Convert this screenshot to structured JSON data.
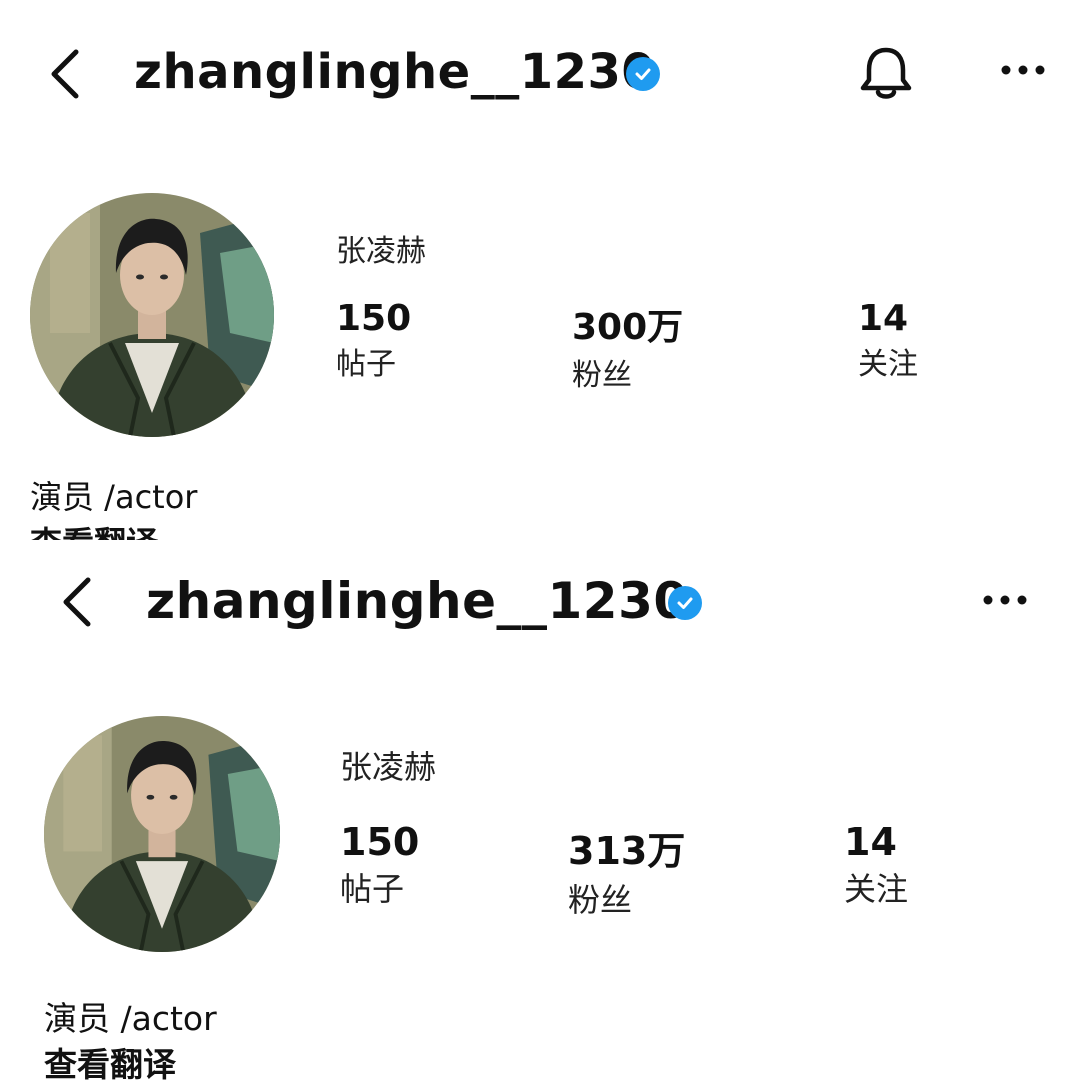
{
  "screenshots": [
    {
      "header": {
        "username": "zhanglinghe__1230",
        "verified": true,
        "has_bell": true
      },
      "profile": {
        "display_name": "张凌赫"
      },
      "stats": [
        {
          "value": "150",
          "label": "帖子"
        },
        {
          "value": "300万",
          "label": "粉丝"
        },
        {
          "value": "14",
          "label": "关注"
        }
      ],
      "bio": "演员 /actor",
      "translate_label": "查看翻译"
    },
    {
      "header": {
        "username": "zhanglinghe__1230",
        "verified": true,
        "has_bell": false
      },
      "profile": {
        "display_name": "张凌赫"
      },
      "stats": [
        {
          "value": "150",
          "label": "帖子"
        },
        {
          "value": "313万",
          "label": "粉丝"
        },
        {
          "value": "14",
          "label": "关注"
        }
      ],
      "bio": "演员 /actor",
      "translate_label": "查看翻译"
    }
  ],
  "colors": {
    "verified_badge": "#1f9bf0",
    "text": "#111111",
    "background": "#ffffff"
  },
  "icons": [
    "back-chevron-icon",
    "verified-badge-icon",
    "bell-icon",
    "more-dots-icon"
  ]
}
